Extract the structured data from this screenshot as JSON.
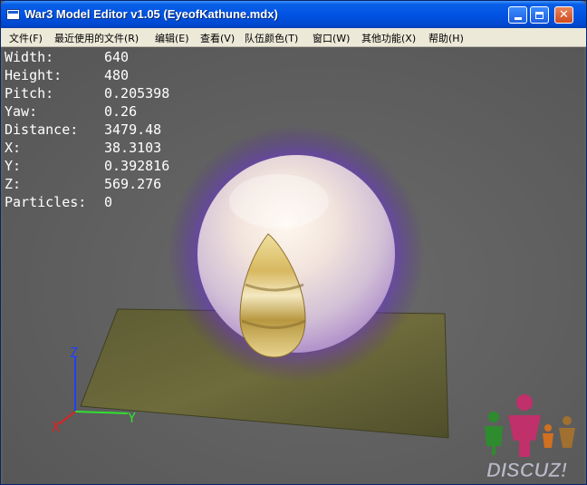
{
  "window": {
    "title": "War3 Model Editor v1.05 (EyeofKathune.mdx)",
    "icons": {
      "app": "window-app-icon",
      "minimize": "minimize-icon",
      "maximize": "maximize-icon",
      "close": "close-icon"
    }
  },
  "menu": {
    "items": [
      {
        "label": "文件(F)"
      },
      {
        "label": "最近使用的文件(R)"
      },
      {
        "label": "编辑(E)"
      },
      {
        "label": "查看(V)"
      },
      {
        "label": "队伍颜色(T)"
      },
      {
        "label": "窗口(W)"
      },
      {
        "label": "其他功能(X)"
      },
      {
        "label": "帮助(H)"
      }
    ]
  },
  "stats": [
    {
      "label": "Width:",
      "value": "640"
    },
    {
      "label": "Height:",
      "value": "480"
    },
    {
      "label": "Pitch:",
      "value": "0.205398"
    },
    {
      "label": "Yaw:",
      "value": "0.26"
    },
    {
      "label": "Distance:",
      "value": "3479.48"
    },
    {
      "label": "X:",
      "value": "38.3103"
    },
    {
      "label": "Y:",
      "value": "0.392816"
    },
    {
      "label": "Z:",
      "value": "569.276"
    },
    {
      "label": "Particles:",
      "value": "0"
    }
  ],
  "axes": {
    "x": "X",
    "y": "Y",
    "z": "Z",
    "colors": {
      "x": "#e02020",
      "y": "#30e030",
      "z": "#2040ff"
    }
  },
  "logo": {
    "text": "DISCUZ!",
    "colors": [
      "#2e8b2e",
      "#c0306a",
      "#d07020",
      "#a07030"
    ]
  },
  "colors": {
    "glow": "#7a3cff",
    "title_bar": "#0054e3",
    "menu_bg": "#ece9d8"
  }
}
